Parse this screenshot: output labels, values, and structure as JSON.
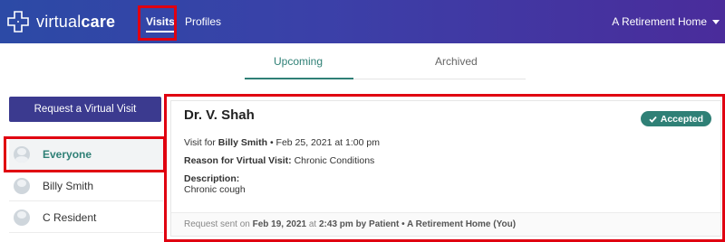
{
  "app": {
    "logo_text_light": "virtual",
    "logo_text_bold": "care"
  },
  "nav": {
    "visits": "Visits",
    "profiles": "Profiles",
    "org": "A Retirement Home"
  },
  "tabs": {
    "upcoming": "Upcoming",
    "archived": "Archived"
  },
  "sidebar": {
    "request_button": "Request a Virtual Visit",
    "items": [
      {
        "label": "Everyone"
      },
      {
        "label": "Billy Smith"
      },
      {
        "label": "C Resident"
      }
    ]
  },
  "visit": {
    "doctor": "Dr. V. Shah",
    "status": "Accepted",
    "visit_for_label": "Visit for",
    "patient": "Billy Smith",
    "date_text": "• Feb 25, 2021 at  1:00 pm",
    "reason_label": "Reason for Virtual Visit:",
    "reason": "Chronic Conditions",
    "description_label": "Description:",
    "description": "Chronic cough",
    "footer_prefix": "Request sent on",
    "footer_date": "Feb 19, 2021",
    "footer_at": "at",
    "footer_time_by": "2:43 pm by Patient • A Retirement Home (You)"
  },
  "colors": {
    "accent_teal": "#2f8076",
    "header_gradient_start": "#2c4aa6",
    "header_gradient_end": "#4a2c9b",
    "button_purple": "#3b3a8f",
    "highlight_red": "#e00010"
  },
  "icons": {
    "logo": "medical-cross-icon",
    "status": "check-icon",
    "dropdown": "chevron-down-icon"
  }
}
